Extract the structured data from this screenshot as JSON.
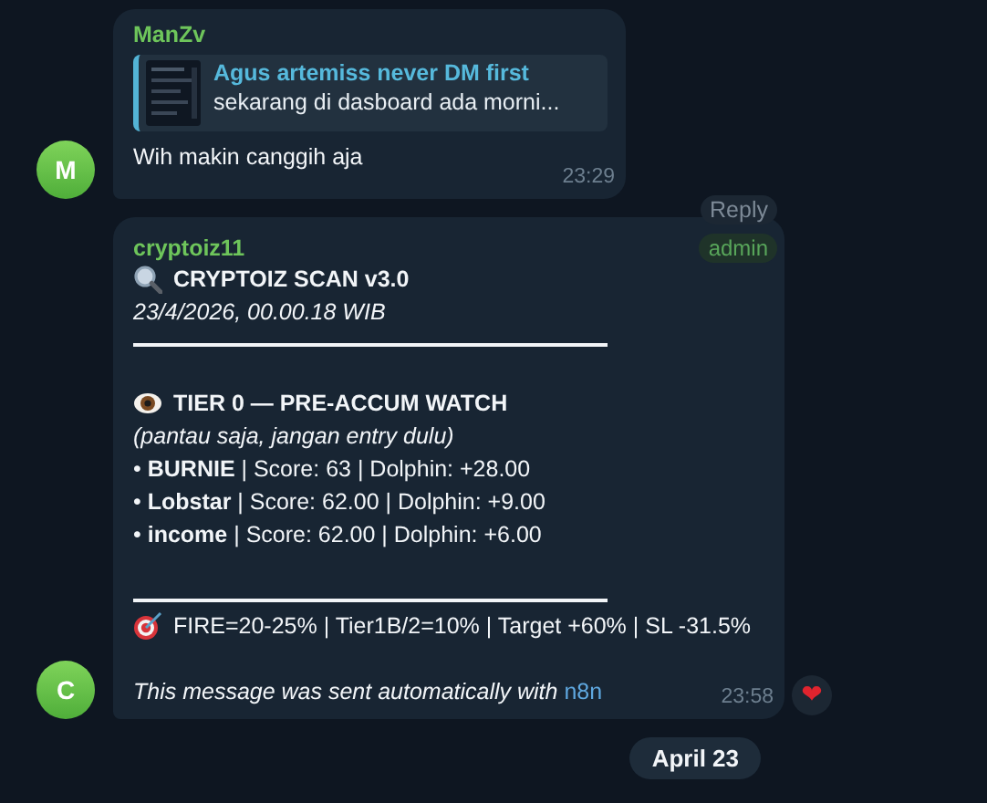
{
  "messages": [
    {
      "sender": "ManZv",
      "avatar": "M",
      "reply": {
        "title": "Agus artemiss never DM first",
        "text": "sekarang di dasboard ada morni..."
      },
      "text": "Wih makin canggih aja",
      "time": "23:29"
    },
    {
      "sender": "cryptoiz11",
      "avatar": "C",
      "reply_button": "Reply",
      "badge": "admin",
      "blocks": [
        {
          "kind": "scan_title",
          "text": "CRYPTOIZ SCAN v3.0"
        },
        {
          "kind": "italic",
          "text": "23/4/2026, 00.00.18 WIB"
        },
        {
          "kind": "rule"
        },
        {
          "kind": "gap"
        },
        {
          "kind": "watch_title",
          "text": "TIER 0 — PRE-ACCUM WATCH"
        },
        {
          "kind": "italic",
          "text": "(pantau saja, jangan entry dulu)"
        },
        {
          "kind": "text",
          "text": "• **BURNIE** | Score: 63 | Dolphin: +28.00"
        },
        {
          "kind": "text",
          "text": "• **Lobstar** | Score: 62.00 | Dolphin: +9.00"
        },
        {
          "kind": "text",
          "text": "• **income** | Score: 62.00 | Dolphin: +6.00"
        },
        {
          "kind": "gap"
        },
        {
          "kind": "rule"
        },
        {
          "kind": "target_line",
          "text": "FIRE=20-25% | Tier1B/2=10% | Target +60% | SL -31.5%"
        },
        {
          "kind": "gap"
        }
      ],
      "footer": "This message was sent automatically with",
      "footer_link": "n8n",
      "time": "23:58",
      "reaction": "❤"
    }
  ],
  "date_pill": "April 23"
}
